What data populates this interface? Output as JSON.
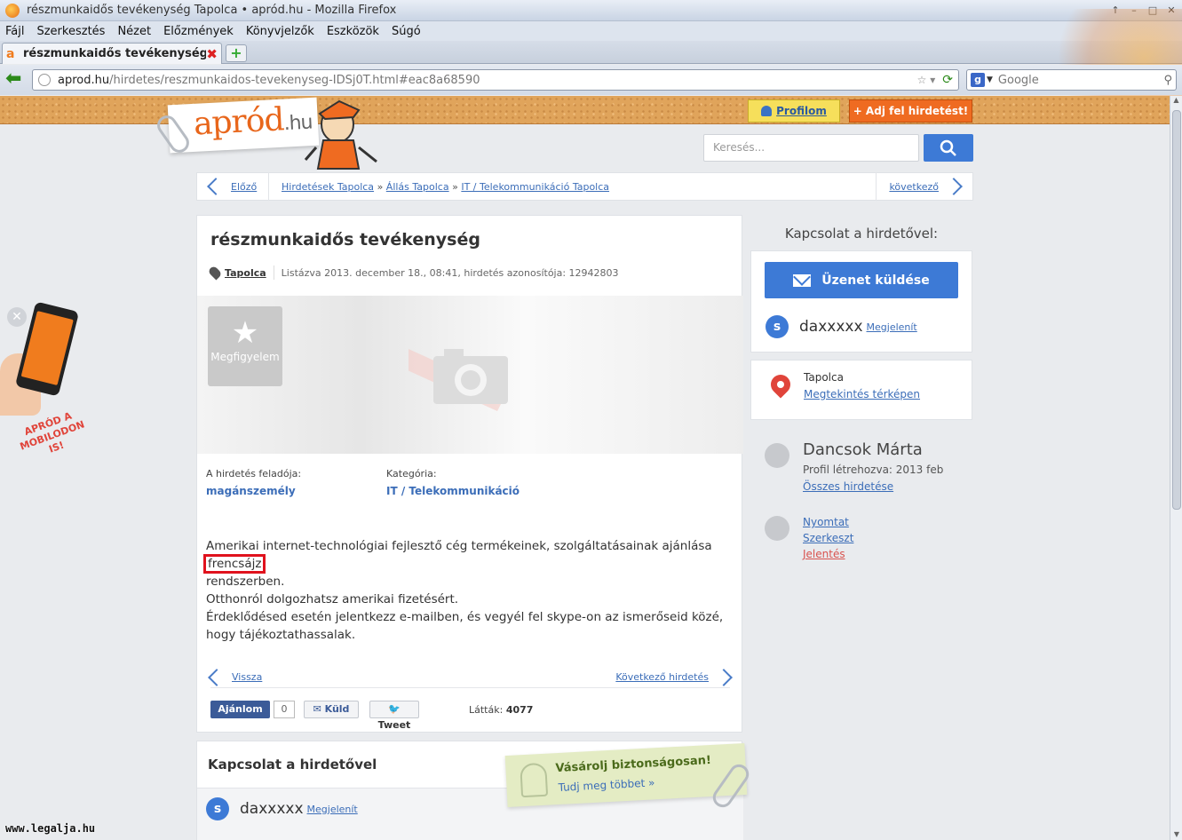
{
  "browser": {
    "window_title": "részmunkaidős tevékenység Tapolca • apród.hu - Mozilla Firefox",
    "menu": [
      "Fájl",
      "Szerkesztés",
      "Nézet",
      "Előzmények",
      "Könyvjelzők",
      "Eszközök",
      "Súgó"
    ],
    "tab_title": "részmunkaidős tevékenység...",
    "url_host": "aprod.hu",
    "url_path": "/hirdetes/reszmunkaidos-tevekenyseg-IDSj0T.html#eac8a68590",
    "search_engine": "Google",
    "search_placeholder": "Google"
  },
  "header": {
    "logo_main": "apród",
    "logo_tld": ".hu",
    "profile_label": "Profilom",
    "add_ad_label": "+ Adj fel hirdetést!",
    "search_placeholder": "Keresés..."
  },
  "breadcrumb": {
    "prev_label": "Előző",
    "items": [
      "Hirdetések Tapolca",
      "Állás Tapolca",
      "IT / Telekommunikáció Tapolca"
    ],
    "separator": "»",
    "next_label": "következő"
  },
  "ad": {
    "title": "részmunkaidős tevékenység",
    "city": "Tapolca",
    "meta": "Listázva 2013. december 18., 08:41, hirdetés azonosítója: 12942803",
    "watch_label": "Megfigyelem",
    "seller_type_label": "A hirdetés feladója:",
    "seller_type_value": "magánszemély",
    "category_label": "Kategória:",
    "category_value": "IT / Telekommunikáció",
    "description_part1": "Amerikai internet-technológiai fejlesztő cég termékeinek, szolgáltatásainak ajánlása ",
    "description_highlight": "frencsájz",
    "description_part2": "rendszerben.",
    "description_line2": "Otthonról dolgozhatsz amerikai fizetésért.",
    "description_line3": "Érdeklődésed esetén jelentkezz e-mailben, és vegyél fel skype-on az ismerőseid közé, hogy tájékoztathassalak.",
    "back_label": "Vissza",
    "next_ad_label": "Következő hirdetés",
    "like_label": "Ajánlom",
    "like_count": "0",
    "send_label": "Küld",
    "tweet_label": "Tweet",
    "views_label": "Látták:",
    "views_count": "4077"
  },
  "contact_card": {
    "title": "Kapcsolat a hirdetővel",
    "skype_handle": "daxxxxx",
    "reveal_label": "Megjelenít"
  },
  "safe_note": {
    "headline": "Vásárolj biztonságosan!",
    "link": "Tudj meg többet »"
  },
  "sidebar": {
    "heading": "Kapcsolat a hirdetővel:",
    "message_button": "Üzenet küldése",
    "skype_handle": "daxxxxx",
    "reveal_label": "Megjelenít",
    "location": "Tapolca",
    "map_link": "Megtekintés térképen",
    "seller_name": "Dancsok Márta",
    "profile_created": "Profil létrehozva: 2013 feb",
    "all_ads_link": "Összes hirdetése",
    "actions": [
      "Nyomtat",
      "Szerkeszt",
      "Jelentés"
    ]
  },
  "promo": {
    "line1": "APRÓD A",
    "line2": "MOBILODON IS!"
  },
  "watermark": "www.legalja.hu",
  "colors": {
    "brand_orange": "#ef6b21",
    "link_blue": "#3b6db8",
    "button_blue": "#3d7ad6",
    "highlight_red": "#e0121d"
  }
}
